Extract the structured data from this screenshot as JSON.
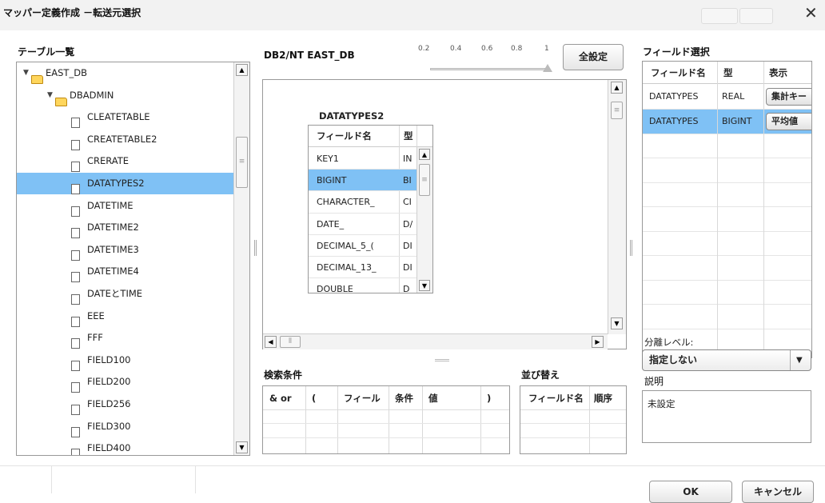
{
  "window": {
    "title": "マッパー定義作成 －転送元選択"
  },
  "table_list": {
    "label": "テーブル一覧",
    "root": "EAST_DB",
    "schema": "DBADMIN",
    "tables": [
      "CLEATETABLE",
      "CREATETABLE2",
      "CRERATE",
      "DATATYPES2",
      "DATETIME",
      "DATETIME2",
      "DATETIME3",
      "DATETIME4",
      "DATEとTIME",
      "EEE",
      "FFF",
      "FIELD100",
      "FIELD200",
      "FIELD256",
      "FIELD300",
      "FIELD400"
    ],
    "selected": "DATATYPES2"
  },
  "canvas": {
    "db_label": "DB2/NT EAST_DB",
    "zoom": {
      "ticks": [
        "0.2",
        "0.4",
        "0.6",
        "0.8",
        "1"
      ],
      "value": 1
    },
    "setall_label": "全設定",
    "table_card": {
      "title": "DATATYPES2",
      "headers": [
        "フィールド名",
        "型"
      ],
      "rows": [
        {
          "name": "KEY1",
          "type": "IN"
        },
        {
          "name": "BIGINT",
          "type": "BI"
        },
        {
          "name": "CHARACTER_",
          "type": "CI"
        },
        {
          "name": "DATE_",
          "type": "D/"
        },
        {
          "name": "DECIMAL_5_(",
          "type": "DI"
        },
        {
          "name": "DECIMAL_13_",
          "type": "DI"
        },
        {
          "name": "DOUBLE",
          "type": "D"
        }
      ],
      "selected_row": 1
    }
  },
  "search": {
    "label": "検索条件",
    "headers": [
      "& or",
      "(",
      "フィール",
      "条件",
      "値",
      ")"
    ]
  },
  "sort": {
    "label": "並び替え",
    "headers": [
      "フィールド名",
      "順序"
    ]
  },
  "fields": {
    "label": "フィールド選択",
    "headers": [
      "フィールド名",
      "型",
      "表示"
    ],
    "rows": [
      {
        "name": "DATATYPES",
        "type": "REAL",
        "display": "集計キー"
      },
      {
        "name": "DATATYPES",
        "type": "BIGINT",
        "display": "平均値"
      }
    ],
    "selected_row": 1
  },
  "separation": {
    "label": "分離レベル:",
    "value": "指定しない"
  },
  "description": {
    "label": "説明",
    "value": "未設定"
  },
  "footer": {
    "ok_label": "OK",
    "cancel_label": "キャンセル"
  },
  "icons": [
    "close-icon",
    "folder-icon",
    "document-icon",
    "expand-triangle-icon",
    "scroll-up-icon",
    "scroll-down-icon",
    "scroll-left-icon",
    "scroll-right-icon",
    "dropdown-arrow-icon",
    "splitter-handle-icon"
  ]
}
